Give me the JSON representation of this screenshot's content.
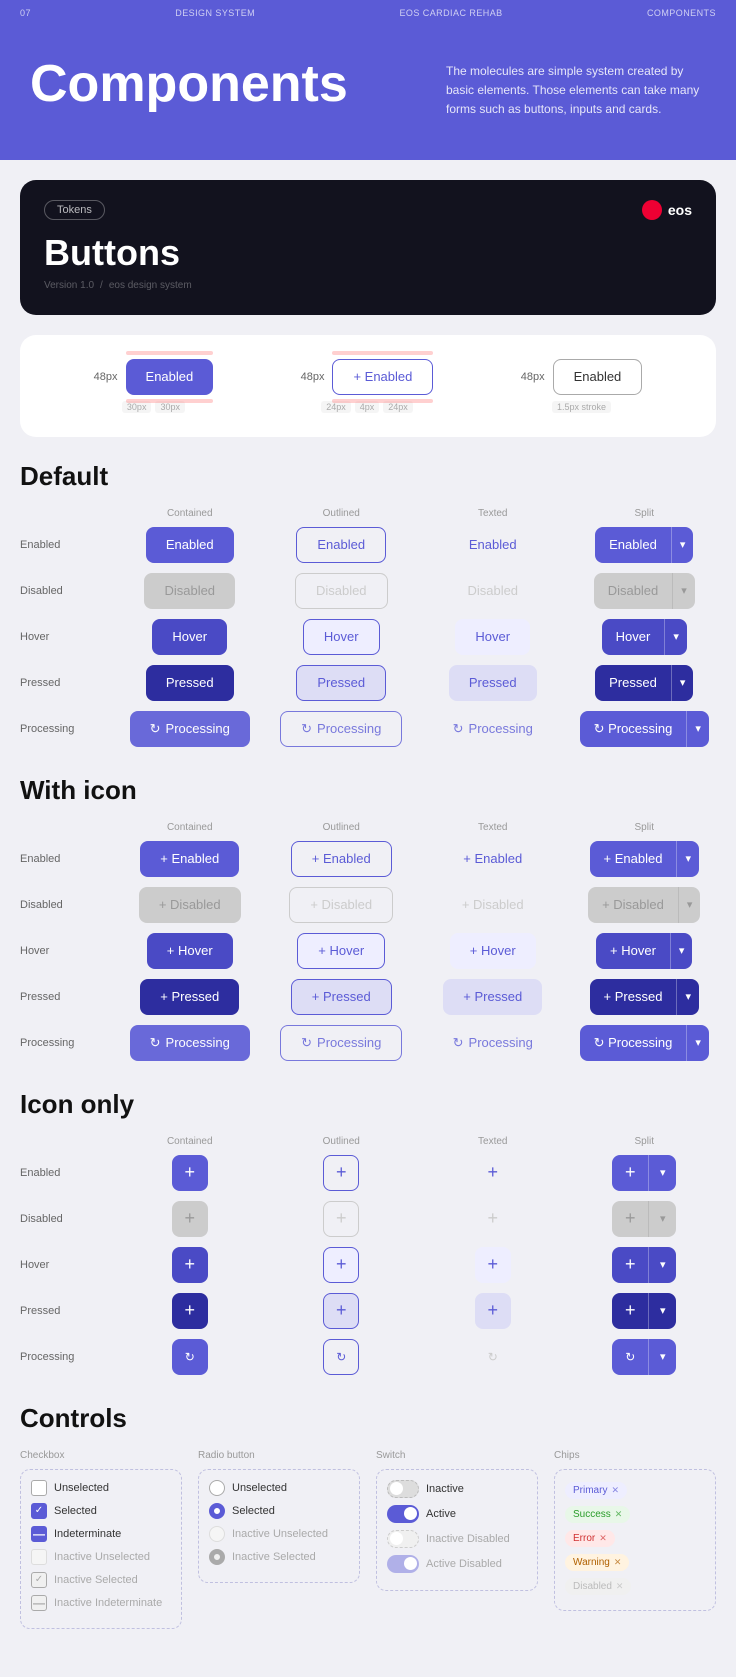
{
  "topbar": {
    "left": "07",
    "center_left": "DESIGN SYSTEM",
    "center": "EOS CARDIAC REHAB",
    "right": "COMPONENTS"
  },
  "hero": {
    "title": "Components",
    "description": "The molecules are simple system created by basic elements. Those elements can take many forms such as buttons, inputs and cards."
  },
  "dark_card": {
    "badge": "Tokens",
    "logo": "eos",
    "title": "Buttons",
    "version": "Version 1.0",
    "slash": "/",
    "design_system": "eos design system"
  },
  "sizes": {
    "contained": {
      "size": "48px",
      "label": "Enabled",
      "p1": "30px",
      "p2": "30px"
    },
    "outlined": {
      "size": "48px",
      "label": "+ Enabled",
      "p1": "24px",
      "p2": "4px",
      "p3": "24px"
    },
    "texted": {
      "size": "48px",
      "label": "Enabled",
      "stroke": "1.5px stroke"
    }
  },
  "default_section": {
    "title": "Default",
    "columns": [
      "",
      "Contained",
      "Outlined",
      "Texted",
      "Split"
    ],
    "rows": [
      {
        "label": "Enabled",
        "contained": "Enabled",
        "outlined": "Enabled",
        "texted": "Enabled",
        "split": "Enabled"
      },
      {
        "label": "Disabled",
        "contained": "Disabled",
        "outlined": "Disabled",
        "texted": "Disabled",
        "split": "Disabled"
      },
      {
        "label": "Hover",
        "contained": "Hover",
        "outlined": "Hover",
        "texted": "Hover",
        "split": "Hover"
      },
      {
        "label": "Pressed",
        "contained": "Pressed",
        "outlined": "Pressed",
        "texted": "Pressed",
        "split": "Pressed"
      },
      {
        "label": "Processing",
        "contained": "Processing",
        "outlined": "Processing",
        "texted": "Processing",
        "split": "Processing"
      }
    ]
  },
  "with_icon_section": {
    "title": "With icon",
    "columns": [
      "",
      "Contained",
      "Outlined",
      "Texted",
      "Split"
    ],
    "rows": [
      {
        "label": "Enabled",
        "contained": "+ Enabled",
        "outlined": "+ Enabled",
        "texted": "+ Enabled",
        "split": "+ Enabled"
      },
      {
        "label": "Disabled",
        "contained": "+ Disabled",
        "outlined": "+ Disabled",
        "texted": "+ Disabled",
        "split": "+ Disabled"
      },
      {
        "label": "Hover",
        "contained": "+ Hover",
        "outlined": "+ Hover",
        "texted": "+ Hover",
        "split": "+ Hover"
      },
      {
        "label": "Pressed",
        "contained": "+ Pressed",
        "outlined": "+ Pressed",
        "texted": "+ Pressed",
        "split": "+ Pressed"
      },
      {
        "label": "Processing",
        "contained": "↻ Processing",
        "outlined": "↻ Processing",
        "texted": "↻ Processing",
        "split": "↻ Processing"
      }
    ]
  },
  "icon_only_section": {
    "title": "Icon only",
    "columns": [
      "",
      "Contained",
      "Outlined",
      "Texted",
      "Split"
    ]
  },
  "controls_section": {
    "title": "Controls",
    "checkbox_title": "Checkbox",
    "radio_title": "Radio button",
    "switch_title": "Switch",
    "chips_title": "Chips",
    "checkbox_items": [
      {
        "label": "Unselected",
        "state": "unselected"
      },
      {
        "label": "Selected",
        "state": "selected"
      },
      {
        "label": "Indeterminate",
        "state": "indeterminate"
      },
      {
        "label": "Inactive Unselected",
        "state": "inactive-unselected"
      },
      {
        "label": "Inactive Selected",
        "state": "inactive-selected"
      },
      {
        "label": "Inactive Indeterminate",
        "state": "inactive-indeterminate"
      }
    ],
    "radio_items": [
      {
        "label": "Unselected",
        "state": "unselected"
      },
      {
        "label": "Selected",
        "state": "selected"
      },
      {
        "label": "Inactive Unselected",
        "state": "inactive-unselected"
      },
      {
        "label": "Inactive Selected",
        "state": "inactive-selected"
      }
    ],
    "switch_items": [
      {
        "label": "Inactive",
        "state": "inactive"
      },
      {
        "label": "Active",
        "state": "active"
      },
      {
        "label": "Inactive Disabled",
        "state": "inactive-disabled"
      },
      {
        "label": "Active Disabled",
        "state": "active-disabled"
      }
    ],
    "chips_items": [
      {
        "label": "Primary",
        "state": "primary"
      },
      {
        "label": "Success",
        "state": "success"
      },
      {
        "label": "Error",
        "state": "error"
      },
      {
        "label": "Warning",
        "state": "warning"
      },
      {
        "label": "Disabled",
        "state": "disabled"
      }
    ]
  }
}
